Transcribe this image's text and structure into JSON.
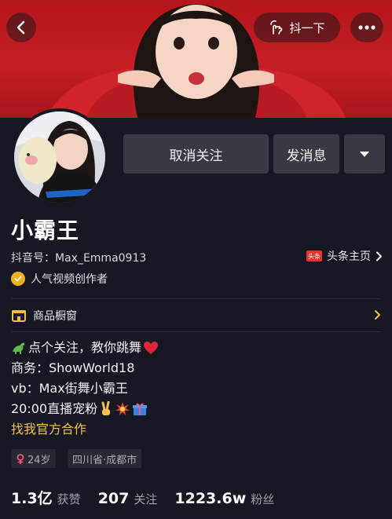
{
  "header": {
    "shake_label": "抖一下",
    "back_icon": "chevron-left-icon",
    "more_icon": "more-dots-icon",
    "shake_icon": "hand-tap-icon"
  },
  "profile": {
    "nickname": "小霸王",
    "douyin_id": "抖音号：Max_Emma0913",
    "toutiao_logo_text": "头条",
    "toutiao_label": "头条主页",
    "certification": "人气视频创作者"
  },
  "actions": {
    "unfollow": "取消关注",
    "message": "发消息"
  },
  "shop": {
    "label": "商品橱窗"
  },
  "bio": {
    "line1": "点个关注，教你跳舞",
    "line2": "商务：ShowWorld18",
    "line3": "vb：Max街舞小霸王",
    "line4": "20:00直播宠粉",
    "line5": "找我官方合作"
  },
  "tags": {
    "age": "24岁",
    "location": "四川省·成都市"
  },
  "stats": {
    "likes_num": "1.3亿",
    "likes_label": "获赞",
    "following_num": "207",
    "following_label": "关注",
    "followers_num": "1223.6w",
    "followers_label": "粉丝"
  },
  "colors": {
    "background": "#161823",
    "header_red": "#c51f24",
    "button_gray": "#393b44",
    "link_yellow": "#f3c142",
    "female_pink": "#f25a7a"
  }
}
